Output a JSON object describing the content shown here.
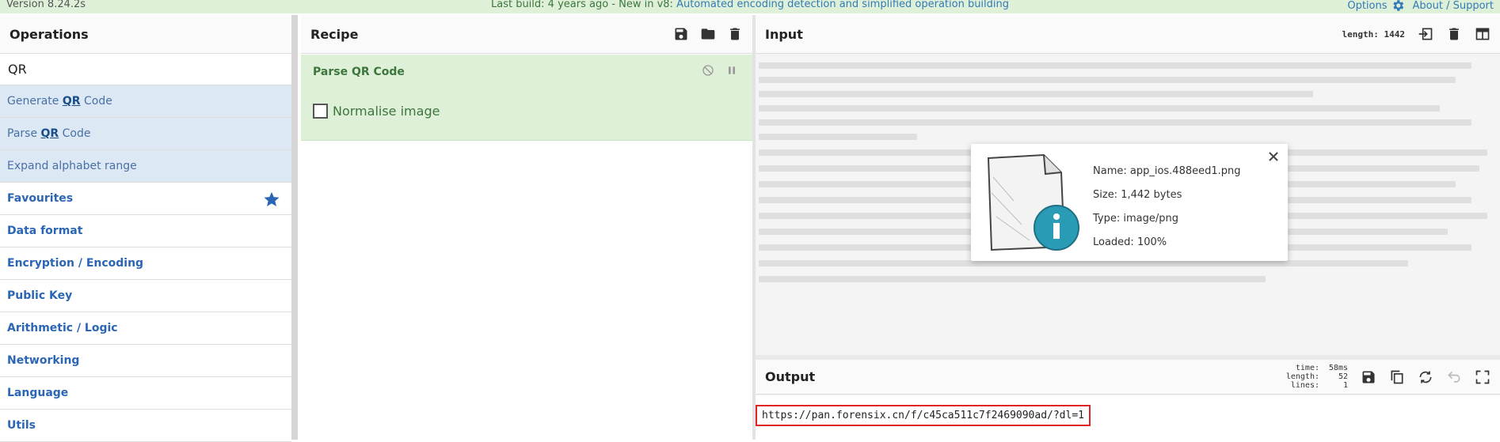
{
  "banner": {
    "version": "Version 8.24.2s",
    "notice_prefix": "Last build: 4 years ago - New in v8: ",
    "notice_link": "Automated encoding detection and simplified operation building",
    "options": "Options",
    "about": "About / Support"
  },
  "operations": {
    "title": "Operations",
    "search_value": "QR",
    "results": [
      {
        "pre": "Generate ",
        "match": "QR",
        "post": " Code"
      },
      {
        "pre": "Parse ",
        "match": "QR",
        "post": " Code"
      },
      {
        "pre": "Expand alphabet range",
        "match": "",
        "post": ""
      }
    ],
    "categories": [
      "Favourites",
      "Data format",
      "Encryption / Encoding",
      "Public Key",
      "Arithmetic / Logic",
      "Networking",
      "Language",
      "Utils"
    ]
  },
  "recipe": {
    "title": "Recipe",
    "op_name": "Parse QR Code",
    "option_label": "Normalise image"
  },
  "input": {
    "title": "Input",
    "length_label": "length: 1442",
    "file": {
      "name": "Name: app_ios.488eed1.png",
      "size": "Size: 1,442 bytes",
      "type": "Type: image/png",
      "loaded": "Loaded: 100%"
    }
  },
  "output": {
    "title": "Output",
    "stats": [
      {
        "k": "time:",
        "v": "58ms"
      },
      {
        "k": "length:",
        "v": "52"
      },
      {
        "k": "lines:",
        "v": "1"
      }
    ],
    "text": "https://pan.forensix.cn/f/c45ca511c7f2469090ad/?dl=1"
  }
}
